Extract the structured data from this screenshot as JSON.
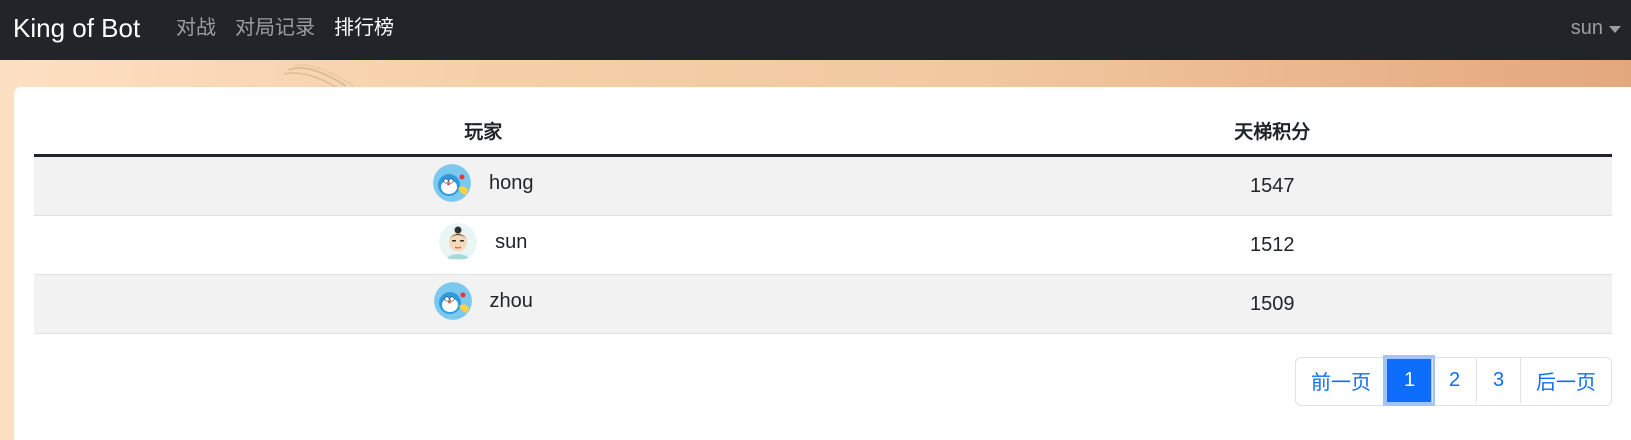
{
  "navbar": {
    "brand": "King of Bot",
    "links": [
      "对战",
      "对局记录",
      "排行榜"
    ],
    "active_link": "排行榜",
    "user": "sun"
  },
  "table": {
    "headers": [
      "玩家",
      "天梯积分"
    ],
    "rows": [
      {
        "name": "hong",
        "rating": "1547",
        "avatar": "doraemon-avatar"
      },
      {
        "name": "sun",
        "rating": "1512",
        "avatar": "cartoon-boy-avatar"
      },
      {
        "name": "zhou",
        "rating": "1509",
        "avatar": "doraemon-avatar"
      }
    ]
  },
  "pagination": {
    "prev": "前一页",
    "pages": [
      "1",
      "2",
      "3"
    ],
    "current": "1",
    "next": "后一页"
  },
  "colors": {
    "navbar_bg": "#212529",
    "accent": "#0d6efd",
    "stripe": "#f2f2f2"
  }
}
